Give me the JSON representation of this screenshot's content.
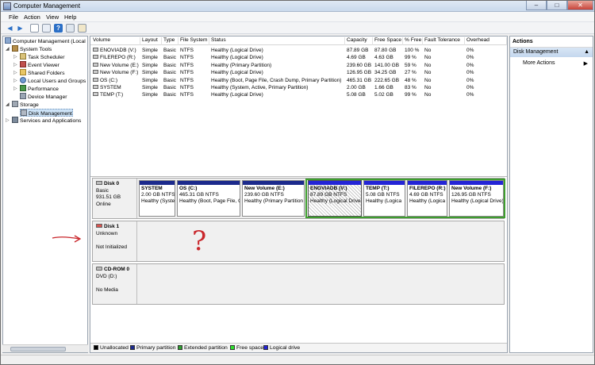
{
  "window": {
    "title": "Computer Management"
  },
  "menu": [
    "File",
    "Action",
    "View",
    "Help"
  ],
  "tree": {
    "root": "Computer Management (Local",
    "system_tools": "System Tools",
    "items": [
      "Task Scheduler",
      "Event Viewer",
      "Shared Folders",
      "Local Users and Groups",
      "Performance",
      "Device Manager"
    ],
    "storage": "Storage",
    "disk_mgmt": "Disk Management",
    "services": "Services and Applications"
  },
  "volume_list": {
    "columns": [
      "Volume",
      "Layout",
      "Type",
      "File System",
      "Status",
      "Capacity",
      "Free Space",
      "% Free",
      "Fault Tolerance",
      "Overhead"
    ],
    "rows": [
      [
        "ENOVIADB (V:)",
        "Simple",
        "Basic",
        "NTFS",
        "Healthy (Logical Drive)",
        "87.89 GB",
        "87.80 GB",
        "100 %",
        "No",
        "0%"
      ],
      [
        "FILEREPO (R:)",
        "Simple",
        "Basic",
        "NTFS",
        "Healthy (Logical Drive)",
        "4.69 GB",
        "4.63 GB",
        "99 %",
        "No",
        "0%"
      ],
      [
        "New Volume (E:)",
        "Simple",
        "Basic",
        "NTFS",
        "Healthy (Primary Partition)",
        "239.60 GB",
        "141.00 GB",
        "59 %",
        "No",
        "0%"
      ],
      [
        "New Volume (F:)",
        "Simple",
        "Basic",
        "NTFS",
        "Healthy (Logical Drive)",
        "126.95 GB",
        "34.25 GB",
        "27 %",
        "No",
        "0%"
      ],
      [
        "OS (C:)",
        "Simple",
        "Basic",
        "NTFS",
        "Healthy (Boot, Page File, Crash Dump, Primary Partition)",
        "465.31 GB",
        "222.65 GB",
        "48 %",
        "No",
        "0%"
      ],
      [
        "SYSTEM",
        "Simple",
        "Basic",
        "NTFS",
        "Healthy (System, Active, Primary Partition)",
        "2.00 GB",
        "1.66 GB",
        "83 %",
        "No",
        "0%"
      ],
      [
        "TEMP (T:)",
        "Simple",
        "Basic",
        "NTFS",
        "Healthy (Logical Drive)",
        "5.08 GB",
        "5.02 GB",
        "99 %",
        "No",
        "0%"
      ]
    ]
  },
  "disk0": {
    "name": "Disk 0",
    "type": "Basic",
    "size": "931.51 GB",
    "status": "Online",
    "partitions": [
      {
        "name": "SYSTEM",
        "size": "2.00 GB NTFS",
        "status": "Healthy (Syste"
      },
      {
        "name": "OS  (C:)",
        "size": "465.31 GB NTFS",
        "status": "Healthy (Boot, Page File, C"
      },
      {
        "name": "New Volume  (E:)",
        "size": "239.60 GB NTFS",
        "status": "Healthy (Primary Partition"
      },
      {
        "name": "ENOVIADB  (V:)",
        "size": "87.89 GB NTFS",
        "status": "Healthy (Logical Drive"
      },
      {
        "name": "TEMP  (T:)",
        "size": "5.08 GB NTFS",
        "status": "Healthy (Logica"
      },
      {
        "name": "FILEREPO  (R:)",
        "size": "4.69 GB NTFS",
        "status": "Healthy (Logica"
      },
      {
        "name": "New Volume  (F:)",
        "size": "126.95 GB NTFS",
        "status": "Healthy (Logical Drive)"
      }
    ]
  },
  "disk1": {
    "name": "Disk 1",
    "type": "Unknown",
    "status": "Not Initialized"
  },
  "cdrom": {
    "name": "CD-ROM 0",
    "type": "DVD (D:)",
    "status": "No Media"
  },
  "legend": [
    "Unallocated",
    "Primary partition",
    "Extended partition",
    "Free space",
    "Logical drive"
  ],
  "legend_colors": [
    "#000000",
    "#1c2a8c",
    "#2f9e2f",
    "#2de02d",
    "#2424d6"
  ],
  "actions": {
    "title": "Actions",
    "section": "Disk Management",
    "more": "More Actions"
  },
  "annotation": {
    "mark": "?"
  }
}
